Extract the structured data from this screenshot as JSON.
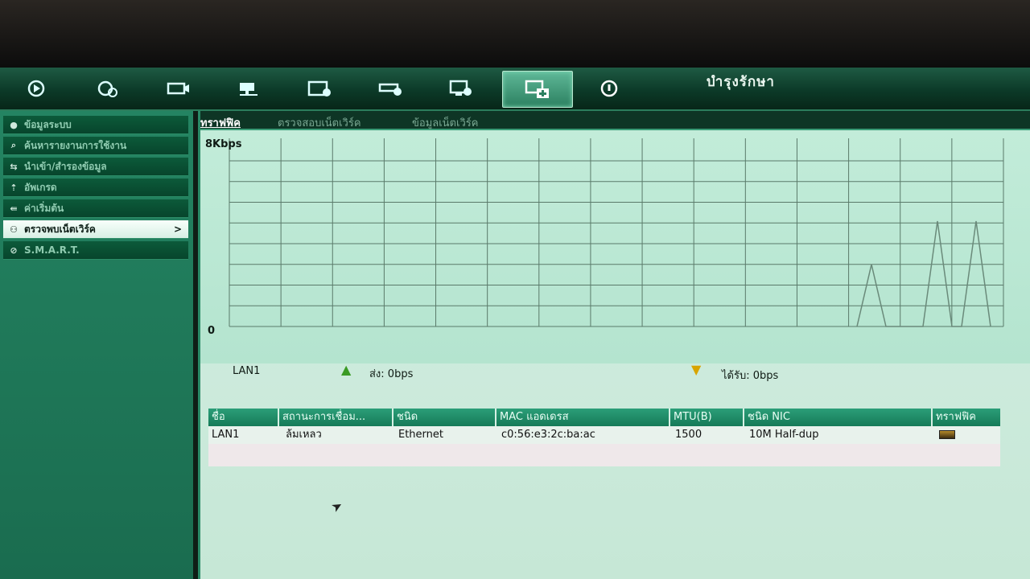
{
  "header": {
    "title": "บำรุงรักษา",
    "toolbar_icons": [
      "playback-icon",
      "camera-settings-icon",
      "record-camera-icon",
      "network-icon",
      "video-config-icon",
      "device-config-icon",
      "system-config-icon",
      "maintenance-icon",
      "shutdown-icon"
    ],
    "active_icon": "maintenance-icon"
  },
  "sidebar": {
    "items": [
      {
        "label": "ข้อมูลระบบ",
        "icon": "info-icon"
      },
      {
        "label": "ค้นหารายงานการใช้งาน",
        "icon": "search-icon"
      },
      {
        "label": "นำเข้า/สำรองข้อมูล",
        "icon": "import-export-icon"
      },
      {
        "label": "อัพเกรด",
        "icon": "upgrade-icon"
      },
      {
        "label": "ค่าเริ่มต้น",
        "icon": "default-icon"
      },
      {
        "label": "ตรวจพบเน็ตเวิร์ค",
        "icon": "network-detect-icon",
        "active": true
      },
      {
        "label": "S.M.A.R.T.",
        "icon": "smart-icon"
      }
    ]
  },
  "tabs": [
    {
      "label": "ทราฟฟิค",
      "active": true
    },
    {
      "label": "ตรวจสอบเน็ตเวิร์ค"
    },
    {
      "label": "ข้อมูลเน็ตเวิร์ค"
    }
  ],
  "graph": {
    "y_max_label": "8Kbps",
    "y_min_label": "0",
    "interface": "LAN1",
    "send_label": "ส่ง: 0bps",
    "receive_label": "ได้รับ: 0bps",
    "traffic_peaks": [
      0.33,
      0.56,
      0.56
    ]
  },
  "table": {
    "columns": [
      "ชื่อ",
      "สถานะการเชื่อม...",
      "ชนิด",
      "MAC แอดเดรส",
      "MTU(B)",
      "ชนิด NIC",
      "ทราฟฟิค"
    ],
    "rows": [
      {
        "name": "LAN1",
        "status": "ล้มเหลว",
        "type": "Ethernet",
        "mac": "c0:56:e3:2c:ba:ac",
        "mtu": "1500",
        "nic": "10M Half-dup"
      }
    ]
  },
  "colors": {
    "accent": "#1e7a56",
    "graph_bg": "#c2ecd9",
    "header_bg": "#0c3a28",
    "send_arrow": "#3a9a24",
    "receive_arrow": "#d8a400"
  }
}
